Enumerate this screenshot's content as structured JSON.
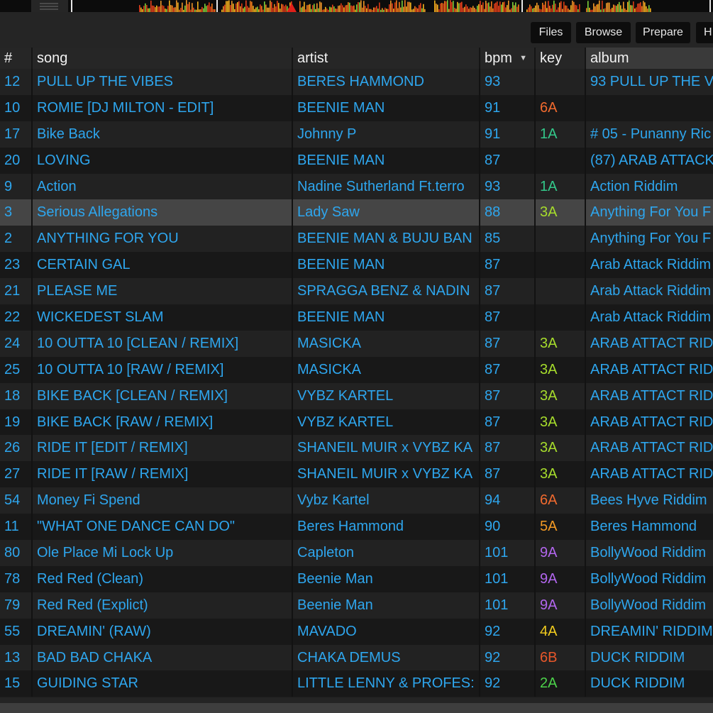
{
  "toolbar": {
    "files_label": "Files",
    "browse_label": "Browse",
    "prepare_label": "Prepare",
    "history_label": "H"
  },
  "columns": {
    "num": "#",
    "song": "song",
    "artist": "artist",
    "bpm": "bpm",
    "key": "key",
    "album": "album"
  },
  "key_colors": {
    "1A": "#33c88a",
    "2A": "#4cd24a",
    "3A": "#a6dc2c",
    "4A": "#f2cc1e",
    "5A": "#f39a24",
    "6A": "#f06a2e",
    "6B": "#e8572a",
    "9A": "#b266ee"
  },
  "rows": [
    {
      "num": "12",
      "song": "PULL UP THE VIBES",
      "artist": "BERES HAMMOND",
      "bpm": "93",
      "key": "",
      "album": "93 PULL UP THE V"
    },
    {
      "num": "10",
      "song": "ROMIE [DJ MILTON - EDIT]",
      "artist": "BEENIE MAN",
      "bpm": "91",
      "key": "6A",
      "album": ""
    },
    {
      "num": "17",
      "song": "Bike Back",
      "artist": "Johnny P",
      "bpm": "91",
      "key": "1A",
      "album": "# 05 - Punanny Ric"
    },
    {
      "num": "20",
      "song": "LOVING",
      "artist": "BEENIE MAN",
      "bpm": "87",
      "key": "",
      "album": "(87) ARAB ATTACK"
    },
    {
      "num": "9",
      "song": "Action",
      "artist": "Nadine Sutherland Ft.terro",
      "bpm": "93",
      "key": "1A",
      "album": "Action Riddim"
    },
    {
      "num": "3",
      "song": "Serious Allegations",
      "artist": "Lady Saw",
      "bpm": "88",
      "key": "3A",
      "album": "Anything For You F",
      "selected": true
    },
    {
      "num": "2",
      "song": "ANYTHING FOR YOU",
      "artist": "BEENIE MAN & BUJU BAN",
      "bpm": "85",
      "key": "",
      "album": "Anything For You F"
    },
    {
      "num": "23",
      "song": "CERTAIN GAL",
      "artist": "BEENIE MAN",
      "bpm": "87",
      "key": "",
      "album": "Arab Attack Riddim"
    },
    {
      "num": "21",
      "song": "PLEASE ME",
      "artist": "SPRAGGA BENZ & NADIN",
      "bpm": "87",
      "key": "",
      "album": "Arab Attack Riddim"
    },
    {
      "num": "22",
      "song": "WICKEDEST SLAM",
      "artist": "BEENIE MAN",
      "bpm": "87",
      "key": "",
      "album": "Arab Attack Riddim"
    },
    {
      "num": "24",
      "song": "10 OUTTA 10 [CLEAN / REMIX]",
      "artist": "MASICKA",
      "bpm": "87",
      "key": "3A",
      "album": "ARAB ATTACT RID"
    },
    {
      "num": "25",
      "song": "10 OUTTA 10 [RAW / REMIX]",
      "artist": "MASICKA",
      "bpm": "87",
      "key": "3A",
      "album": "ARAB ATTACT RID"
    },
    {
      "num": "18",
      "song": "BIKE BACK [CLEAN / REMIX]",
      "artist": "VYBZ KARTEL",
      "bpm": "87",
      "key": "3A",
      "album": "ARAB ATTACT RID"
    },
    {
      "num": "19",
      "song": "BIKE BACK [RAW / REMIX]",
      "artist": "VYBZ KARTEL",
      "bpm": "87",
      "key": "3A",
      "album": "ARAB ATTACT RID"
    },
    {
      "num": "26",
      "song": "RIDE IT [EDIT / REMIX]",
      "artist": "SHANEIL MUIR x VYBZ KA",
      "bpm": "87",
      "key": "3A",
      "album": "ARAB ATTACT RID"
    },
    {
      "num": "27",
      "song": "RIDE IT [RAW / REMIX]",
      "artist": "SHANEIL MUIR x VYBZ KA",
      "bpm": "87",
      "key": "3A",
      "album": "ARAB ATTACT RID"
    },
    {
      "num": "54",
      "song": "Money Fi Spend",
      "artist": "Vybz Kartel",
      "bpm": "94",
      "key": "6A",
      "album": "Bees Hyve Riddim"
    },
    {
      "num": "11",
      "song": "\"WHAT ONE DANCE CAN DO\"",
      "artist": "Beres Hammond",
      "bpm": "90",
      "key": "5A",
      "album": "Beres Hammond"
    },
    {
      "num": "80",
      "song": "Ole Place Mi Lock Up",
      "artist": "Capleton",
      "bpm": "101",
      "key": "9A",
      "album": "BollyWood Riddim"
    },
    {
      "num": "78",
      "song": "Red Red (Clean)",
      "artist": "Beenie Man",
      "bpm": "101",
      "key": "9A",
      "album": "BollyWood Riddim"
    },
    {
      "num": "79",
      "song": "Red Red (Explict)",
      "artist": "Beenie Man",
      "bpm": "101",
      "key": "9A",
      "album": "BollyWood Riddim"
    },
    {
      "num": "55",
      "song": "DREAMIN' (RAW)",
      "artist": "MAVADO",
      "bpm": "92",
      "key": "4A",
      "album": "DREAMIN' RIDDIM"
    },
    {
      "num": "13",
      "song": "BAD BAD CHAKA",
      "artist": "CHAKA DEMUS",
      "bpm": "92",
      "key": "6B",
      "album": "DUCK RIDDIM"
    },
    {
      "num": "15",
      "song": "GUIDING STAR",
      "artist": "LITTLE LENNY & PROFES:",
      "bpm": "92",
      "key": "2A",
      "album": "DUCK RIDDIM"
    }
  ]
}
